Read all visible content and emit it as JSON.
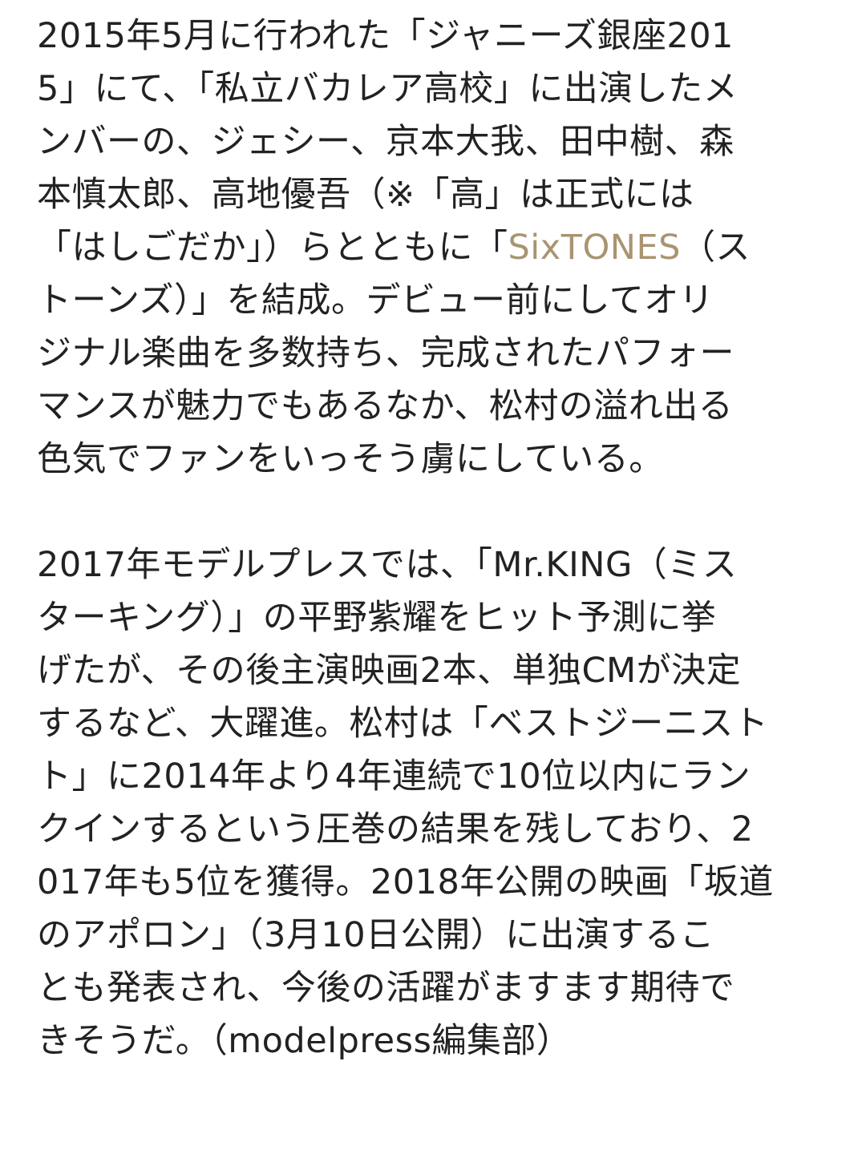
{
  "article": {
    "paragraph1": {
      "line1": "2015年5月に行われた「ジャニーズ銀座201",
      "line2": "5」にて、「私立バカレア高校」に出演したメ",
      "line3": "ンバーの、ジェシー、京本大我、田中樹、森",
      "line4": "本慎太郎、高地優吾（※「高」は正式には",
      "line5_before": "「はしごだか」）らとともに「",
      "line5_link": "SixTONES",
      "line5_after": "（ス",
      "line6": "トーンズ）」を結成。デビュー前にしてオリ",
      "line7": "ジナル楽曲を多数持ち、完成されたパフォー",
      "line8": "マンスが魅力でもあるなか、松村の溢れ出る",
      "line9": "色気でファンをいっそう虜にしている。"
    },
    "paragraph2": {
      "line1": "2017年モデルプレスでは、「Mr.KING（ミス",
      "line2": "ターキング）」の平野紫耀をヒット予測に挙",
      "line3": "げたが、その後主演映画2本、単独CMが決定",
      "line4": "するなど、大躍進。松村は「ベストジーニスト",
      "line5": "ト」に2014年より4年連続で10位以内にラン",
      "line6": "クインするという圧巻の結果を残しており、2",
      "line7": "017年も5位を獲得。2018年公開の映画「坂道",
      "line8": "のアポロン」（3月10日公開）に出演するこ",
      "line9": "とも発表され、今後の活躍がますます期待で",
      "line10": "きそうだ。（modelpress編集部）"
    }
  },
  "colors": {
    "text": "#222222",
    "link": "#a99470",
    "background": "#ffffff"
  }
}
